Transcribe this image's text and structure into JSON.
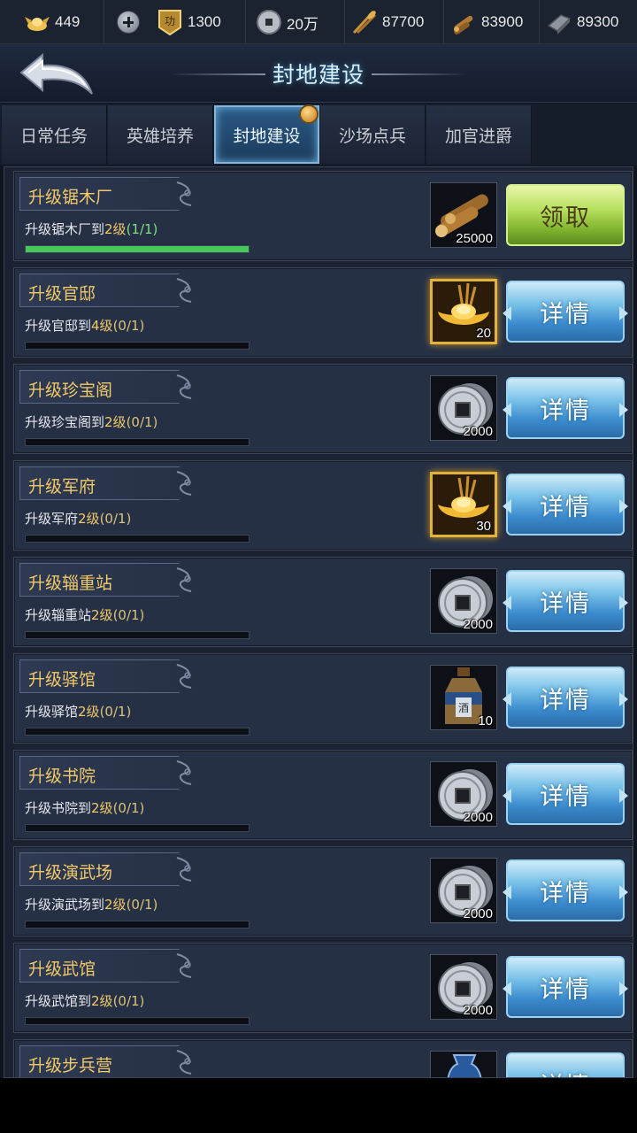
{
  "resources": [
    {
      "icon": "gold-ingot-wings-icon",
      "value": "449"
    },
    {
      "icon": "merit-badge-icon",
      "value": "1300"
    },
    {
      "icon": "coin-icon",
      "value": "20万"
    },
    {
      "icon": "grain-icon",
      "value": "87700"
    },
    {
      "icon": "wood-icon",
      "value": "83900"
    },
    {
      "icon": "iron-icon",
      "value": "89300"
    }
  ],
  "header": {
    "title": "封地建设"
  },
  "tabs": [
    {
      "label": "日常任务",
      "active": false
    },
    {
      "label": "英雄培养",
      "active": false
    },
    {
      "label": "封地建设",
      "active": true
    },
    {
      "label": "沙场点兵",
      "active": false
    },
    {
      "label": "加官进爵",
      "active": false
    }
  ],
  "tasks": [
    {
      "name": "升级锯木厂",
      "desc_pre": "升级锯木厂到",
      "level": "2级",
      "count": "(1/1)",
      "progress": 1.0,
      "reward_icon": "wood-icon",
      "reward_qty": "25000",
      "button": "领取"
    },
    {
      "name": "升级官邸",
      "desc_pre": "升级官邸到",
      "level": "4级",
      "count": "(0/1)",
      "progress": 0.0,
      "reward_icon": "gold-ingot-icon",
      "reward_qty": "20",
      "button": "详情"
    },
    {
      "name": "升级珍宝阁",
      "desc_pre": "升级珍宝阁到",
      "level": "2级",
      "count": "(0/1)",
      "progress": 0.0,
      "reward_icon": "coin-icon",
      "reward_qty": "2000",
      "button": "详情"
    },
    {
      "name": "升级军府",
      "desc_pre": "升级军府",
      "level": "2级",
      "count": "(0/1)",
      "progress": 0.0,
      "reward_icon": "gold-ingot-icon",
      "reward_qty": "30",
      "button": "详情"
    },
    {
      "name": "升级辎重站",
      "desc_pre": "升级辎重站",
      "level": "2级",
      "count": "(0/1)",
      "progress": 0.0,
      "reward_icon": "coin-icon",
      "reward_qty": "2000",
      "button": "详情"
    },
    {
      "name": "升级驿馆",
      "desc_pre": "升级驿馆",
      "level": "2级",
      "count": "(0/1)",
      "progress": 0.0,
      "reward_icon": "potion-bottle-icon",
      "reward_qty": "10",
      "button": "详情"
    },
    {
      "name": "升级书院",
      "desc_pre": "升级书院到",
      "level": "2级",
      "count": "(0/1)",
      "progress": 0.0,
      "reward_icon": "coin-icon",
      "reward_qty": "2000",
      "button": "详情"
    },
    {
      "name": "升级演武场",
      "desc_pre": "升级演武场到",
      "level": "2级",
      "count": "(0/1)",
      "progress": 0.0,
      "reward_icon": "coin-icon",
      "reward_qty": "2000",
      "button": "详情"
    },
    {
      "name": "升级武馆",
      "desc_pre": "升级武馆到",
      "level": "2级",
      "count": "(0/1)",
      "progress": 0.0,
      "reward_icon": "coin-icon",
      "reward_qty": "2000",
      "button": "详情"
    },
    {
      "name": "升级步兵营",
      "desc_pre": "",
      "level": "",
      "count": "",
      "progress": 0.0,
      "reward_icon": "vase-icon",
      "reward_qty": "",
      "button": "详情"
    }
  ],
  "colors": {
    "accent_gold": "#f1c96a",
    "progress_green": "#47c95a",
    "done_green": "#7ee081"
  }
}
